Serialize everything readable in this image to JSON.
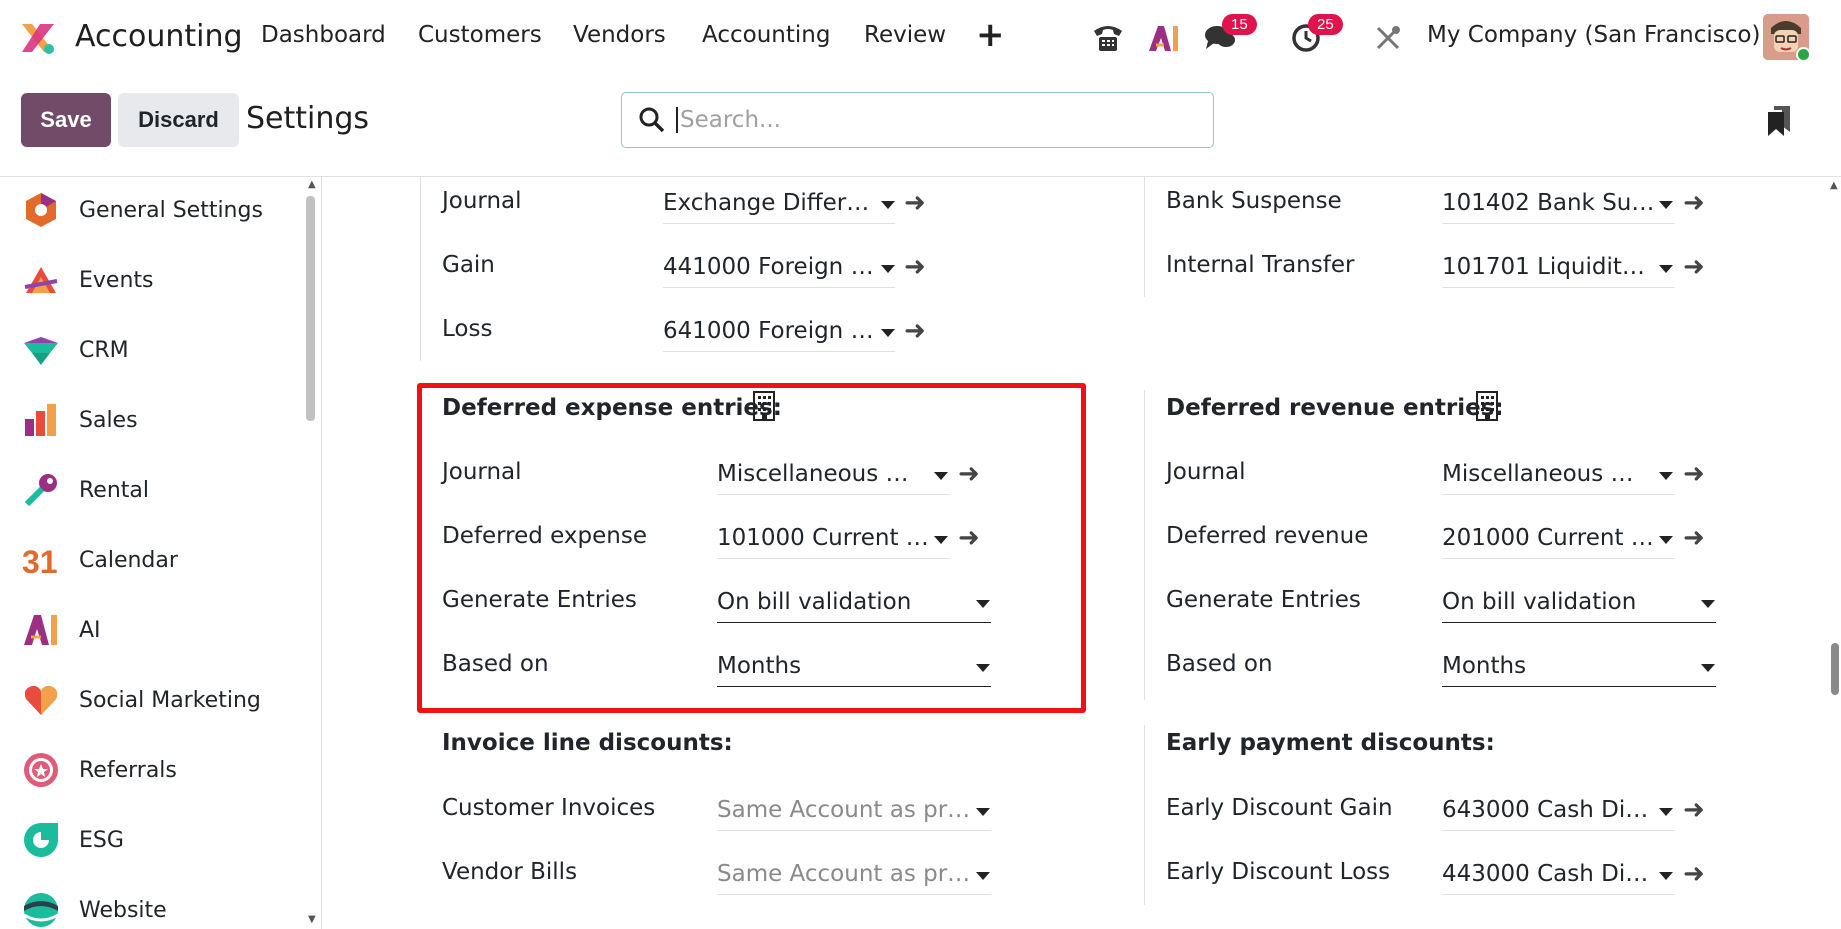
{
  "topbar": {
    "app_name": "Accounting",
    "menu": [
      "Dashboard",
      "Customers",
      "Vendors",
      "Accounting",
      "Review"
    ],
    "plus": "+",
    "messages_count": "15",
    "activities_count": "25",
    "company": "My Company (San Francisco)"
  },
  "controls": {
    "save_label": "Save",
    "discard_label": "Discard",
    "title": "Settings",
    "search_placeholder": "Search..."
  },
  "sidebar": {
    "items": [
      {
        "label": "General Settings",
        "icon": "settings-icon"
      },
      {
        "label": "Events",
        "icon": "events-icon"
      },
      {
        "label": "CRM",
        "icon": "crm-icon"
      },
      {
        "label": "Sales",
        "icon": "sales-icon"
      },
      {
        "label": "Rental",
        "icon": "rental-icon"
      },
      {
        "label": "Calendar",
        "icon": "calendar-icon"
      },
      {
        "label": "AI",
        "icon": "ai-icon"
      },
      {
        "label": "Social Marketing",
        "icon": "social-marketing-icon"
      },
      {
        "label": "Referrals",
        "icon": "referrals-icon"
      },
      {
        "label": "ESG",
        "icon": "esg-icon"
      },
      {
        "label": "Website",
        "icon": "website-icon"
      }
    ],
    "calendar_number": "31"
  },
  "left": {
    "exchange": {
      "journal_label": "Journal",
      "journal_value": "Exchange Differ…",
      "gain_label": "Gain",
      "gain_value": "441000 Foreign …",
      "loss_label": "Loss",
      "loss_value": "641000 Foreign …"
    },
    "deferred_expense": {
      "title": "Deferred expense entries:",
      "journal_label": "Journal",
      "journal_value": "Miscellaneous …",
      "account_label": "Deferred expense",
      "account_value": "101000 Current …",
      "generate_label": "Generate Entries",
      "generate_value": "On bill validation",
      "based_label": "Based on",
      "based_value": "Months"
    },
    "invoice_discounts": {
      "title": "Invoice line discounts:",
      "customer_label": "Customer Invoices",
      "customer_placeholder": "Same Account as pr…",
      "vendor_label": "Vendor Bills",
      "vendor_placeholder": "Same Account as pr…"
    }
  },
  "right": {
    "bank": {
      "suspense_label": "Bank Suspense",
      "suspense_value": "101402 Bank Su…",
      "transfer_label": "Internal Transfer",
      "transfer_value": "101701 Liquidit…"
    },
    "deferred_revenue": {
      "title": "Deferred revenue entries:",
      "journal_label": "Journal",
      "journal_value": "Miscellaneous …",
      "account_label": "Deferred revenue",
      "account_value": "201000 Current …",
      "generate_label": "Generate Entries",
      "generate_value": "On bill validation",
      "based_label": "Based on",
      "based_value": "Months"
    },
    "early_payment": {
      "title": "Early payment discounts:",
      "gain_label": "Early Discount Gain",
      "gain_value": "643000 Cash Di…",
      "loss_label": "Early Discount Loss",
      "loss_value": "443000 Cash Di…"
    }
  },
  "colors": {
    "brand": "#714b67",
    "highlight": "#f01212",
    "badge": "#e0144c"
  }
}
